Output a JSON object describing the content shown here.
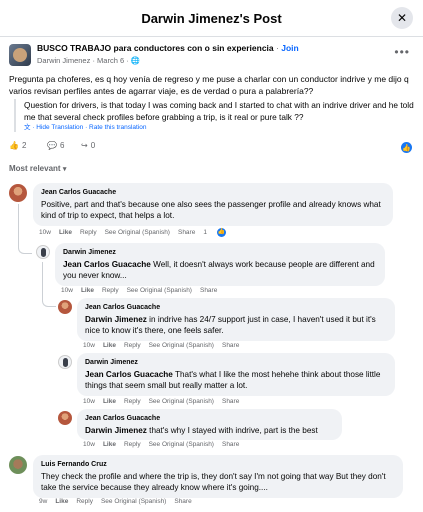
{
  "header": {
    "title": "Darwin Jimenez's Post"
  },
  "post": {
    "group": "BUSCO TRABAJO para conductores con o sin experiencia",
    "join": "Join",
    "author": "Darwin Jimenez",
    "date": "March 6",
    "text": "Pregunta pa choferes, es q hoy venía de regreso y me puse a charlar con un conductor indrive y me dijo q varios revisan perfiles antes de agarrar viaje, es de verdad o pura a palabrería??",
    "translation": "Question for drivers, is that today I was coming back and I started to chat with an indrive driver and he told me that several check profiles before grabbing a trip, is it real or pure talk ??",
    "hide_translation": "Hide Translation",
    "rate_translation": "Rate this translation",
    "likes": "2",
    "comments": "6",
    "shares": "0"
  },
  "filter": {
    "label": "Most relevant"
  },
  "comments": [
    {
      "name": "Jean Carlos Guacache",
      "mention": "",
      "text": "Positive, part and that's because one also sees the passenger profile and already knows what kind of trip to expect, that helps a lot.",
      "time": "10w",
      "like": "Like",
      "reply": "Reply",
      "original": "See Original (Spanish)",
      "share": "Share",
      "reactions": "1"
    },
    {
      "name": "Darwin Jimenez",
      "mention": "Jean Carlos Guacache",
      "text": " Well, it doesn't always work because people are different and you never know...",
      "time": "10w",
      "like": "Like",
      "reply": "Reply",
      "original": "See Original (Spanish)",
      "share": "Share"
    },
    {
      "name": "Jean Carlos Guacache",
      "mention": "Darwin Jimenez",
      "text": " in indrive has 24/7 support just in case, I haven't used it but it's nice to know it's there, one feels safer.",
      "time": "10w",
      "like": "Like",
      "reply": "Reply",
      "original": "See Original (Spanish)",
      "share": "Share"
    },
    {
      "name": "Darwin Jimenez",
      "mention": "Jean Carlos Guacache",
      "text": " That's what I like the most hehehe think about those little things that seem small but really matter a lot.",
      "time": "10w",
      "like": "Like",
      "reply": "Reply",
      "original": "See Original (Spanish)",
      "share": "Share"
    },
    {
      "name": "Jean Carlos Guacache",
      "mention": "Darwin Jimenez",
      "text": " that's why I stayed with indrive, part is the best",
      "time": "10w",
      "like": "Like",
      "reply": "Reply",
      "original": "See Original (Spanish)",
      "share": "Share"
    },
    {
      "name": "Luis Fernando Cruz",
      "mention": "",
      "text": "They check the profile and where the trip is, they don't say I'm not going that way But they don't take the service because they already know where it's going....",
      "time": "9w",
      "like": "Like",
      "reply": "Reply",
      "original": "See Original (Spanish)",
      "share": "Share"
    }
  ]
}
